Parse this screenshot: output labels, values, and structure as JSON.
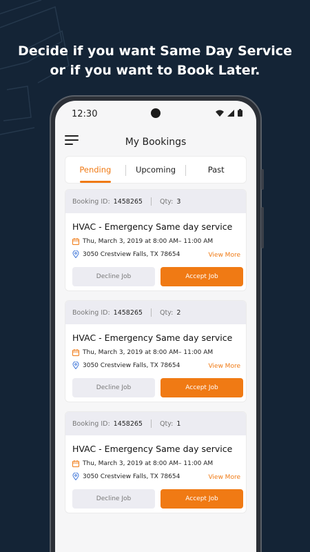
{
  "headline": {
    "line1": "Decide if you want Same Day Service",
    "line2": "or if you want to Book Later."
  },
  "statusbar": {
    "time": "12:30",
    "icons": [
      "wifi-icon",
      "signal-icon",
      "battery-icon"
    ]
  },
  "appbar": {
    "title": "My Bookings",
    "menu_icon": "hamburger-menu-icon"
  },
  "tabs": [
    {
      "label": "Pending",
      "active": true
    },
    {
      "label": "Upcoming",
      "active": false
    },
    {
      "label": "Past",
      "active": false
    }
  ],
  "bookings": [
    {
      "id_label": "Booking ID:",
      "id": "1458265",
      "qty_label": "Qty:",
      "qty": "3",
      "title": "HVAC - Emergency Same day service",
      "datetime": "Thu, March 3, 2019 at 8:00 AM– 11:00 AM",
      "address": "3050 Crestview Falls, TX 78654",
      "view_more": "View More",
      "decline": "Decline Job",
      "accept": "Accept Job"
    },
    {
      "id_label": "Booking ID:",
      "id": "1458265",
      "qty_label": "Qty:",
      "qty": "2",
      "title": "HVAC - Emergency Same day service",
      "datetime": "Thu, March 3, 2019 at 8:00 AM– 11:00 AM",
      "address": "3050 Crestview Falls, TX 78654",
      "view_more": "View More",
      "decline": "Decline Job",
      "accept": "Accept Job"
    },
    {
      "id_label": "Booking ID:",
      "id": "1458265",
      "qty_label": "Qty:",
      "qty": "1",
      "title": "HVAC - Emergency Same day service",
      "datetime": "Thu, March 3, 2019 at 8:00 AM– 11:00 AM",
      "address": "3050 Crestview Falls, TX 78654",
      "view_more": "View More",
      "decline": "Decline Job",
      "accept": "Accept Job"
    }
  ],
  "colors": {
    "background": "#142436",
    "accent": "#f07a14",
    "card_header": "#ececf2"
  }
}
